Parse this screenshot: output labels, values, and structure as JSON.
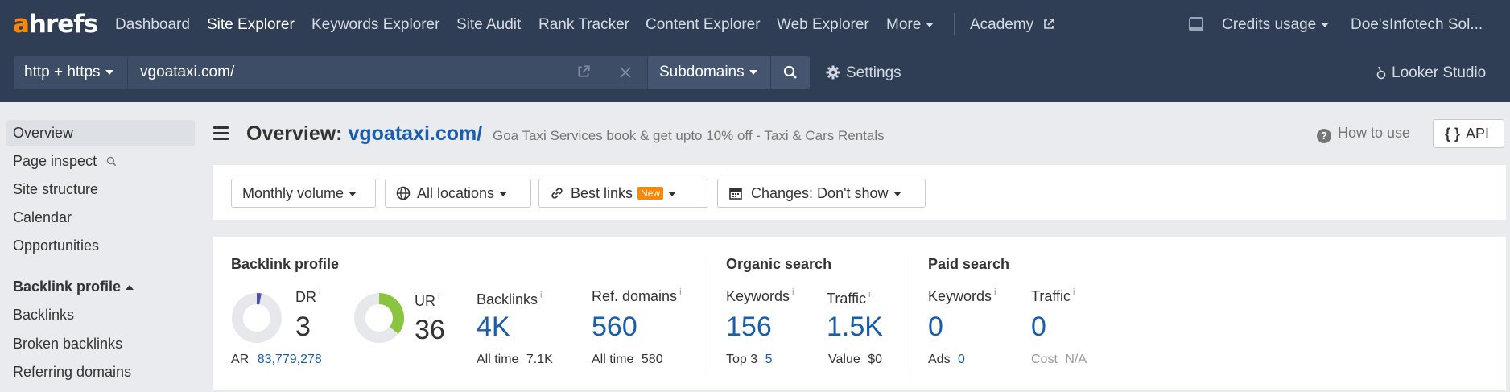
{
  "nav": {
    "logo_a": "a",
    "logo_rest": "hrefs",
    "items": [
      "Dashboard",
      "Site Explorer",
      "Keywords Explorer",
      "Site Audit",
      "Rank Tracker",
      "Content Explorer",
      "Web Explorer",
      "More"
    ],
    "academy": "Academy",
    "credits": "Credits usage",
    "account": "Doe'sInfotech Sol..."
  },
  "search": {
    "protocol": "http + https",
    "url": "vgoataxi.com/",
    "mode": "Subdomains",
    "settings": "Settings",
    "looker": "Looker Studio"
  },
  "sidebar": {
    "items": [
      "Overview",
      "Page inspect",
      "Site structure",
      "Calendar",
      "Opportunities"
    ],
    "section": "Backlink profile",
    "section_items": [
      "Backlinks",
      "Broken backlinks",
      "Referring domains"
    ]
  },
  "header": {
    "title_prefix": "Overview:",
    "title_url": "vgoataxi.com/",
    "description": "Goa Taxi Services book & get upto 10% off - Taxi & Cars Rentals",
    "how_to_use": "How to use",
    "api": "API"
  },
  "filters": {
    "volume": "Monthly volume",
    "locations": "All locations",
    "best_links": "Best links",
    "new_badge": "New",
    "changes": "Changes: Don't show"
  },
  "backlink": {
    "title": "Backlink profile",
    "dr_label": "DR",
    "dr_value": "3",
    "dr_fraction": 0.03,
    "ar_label": "AR",
    "ar_value": "83,779,278",
    "ur_label": "UR",
    "ur_value": "36",
    "ur_fraction": 0.36,
    "backlinks_label": "Backlinks",
    "backlinks_value": "4K",
    "backlinks_alltime_label": "All time",
    "backlinks_alltime": "7.1K",
    "refdomains_label": "Ref. domains",
    "refdomains_value": "560",
    "refdomains_alltime_label": "All time",
    "refdomains_alltime": "580"
  },
  "organic": {
    "title": "Organic search",
    "keywords_label": "Keywords",
    "keywords_value": "156",
    "top3_label": "Top 3",
    "top3_value": "5",
    "traffic_label": "Traffic",
    "traffic_value": "1.5K",
    "value_label": "Value",
    "value_value": "$0"
  },
  "paid": {
    "title": "Paid search",
    "keywords_label": "Keywords",
    "keywords_value": "0",
    "ads_label": "Ads",
    "ads_value": "0",
    "traffic_label": "Traffic",
    "traffic_value": "0",
    "cost_label": "Cost",
    "cost_value": "N/A"
  },
  "info_mark": "i",
  "colors": {
    "nav_bg": "#2f3e55",
    "accent": "#ff8800",
    "link": "#1a5dab",
    "ur_green": "#8cc43f",
    "dr_blue": "#4a4fb5"
  }
}
